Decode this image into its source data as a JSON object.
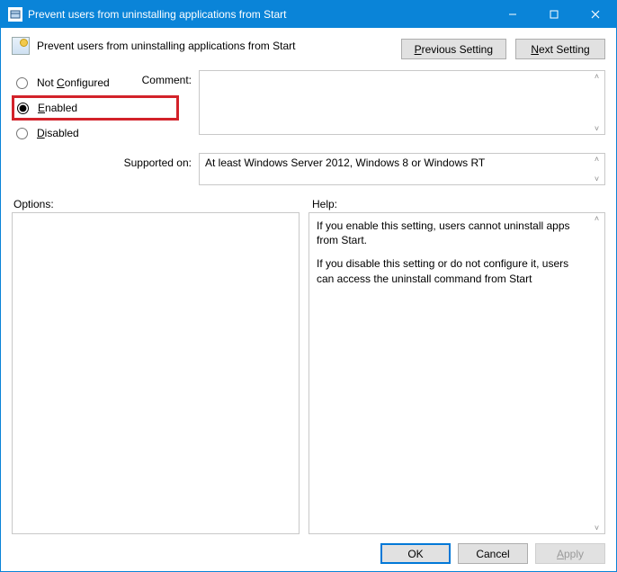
{
  "window": {
    "title": "Prevent users from uninstalling applications from Start"
  },
  "header": {
    "heading": "Prevent users from uninstalling applications from Start",
    "prev_label_pre": "P",
    "prev_label_post": "revious Setting",
    "next_label_pre": "N",
    "next_label_post": "ext Setting"
  },
  "state": {
    "not_configured_label": "Not Configured",
    "not_configured_underline": "C",
    "enabled_label_pre": "E",
    "enabled_label_post": "nabled",
    "disabled_label_pre": "D",
    "disabled_label_post": "isabled",
    "selected": "enabled"
  },
  "comment": {
    "label": "Comment:",
    "value": ""
  },
  "supported": {
    "label": "Supported on:",
    "value": "At least Windows Server 2012, Windows 8 or Windows RT"
  },
  "options": {
    "label": "Options:"
  },
  "help": {
    "label": "Help:",
    "para1": "If you enable this setting, users cannot uninstall apps from Start.",
    "para2": "If you disable this setting or do not configure it, users can access the uninstall command from Start"
  },
  "footer": {
    "ok": "OK",
    "cancel": "Cancel",
    "apply_pre": "A",
    "apply_post": "pply"
  }
}
